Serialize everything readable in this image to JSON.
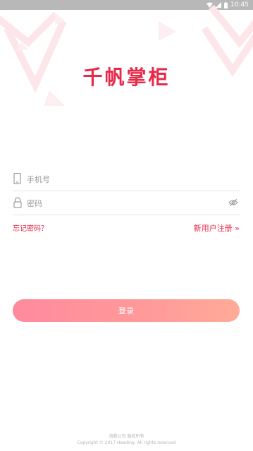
{
  "status_bar": {
    "time": "10:45"
  },
  "brand": {
    "title": "千帆掌柜"
  },
  "form": {
    "phone_placeholder": "手机号",
    "password_placeholder": "密码"
  },
  "links": {
    "forgot_password": "忘记密码？",
    "register": "新用户注册 »"
  },
  "login_button": "登录",
  "footer": {
    "company": "海鼎公司 版权所有",
    "copyright": "Copyright © 2017 Heading. All rights reserved"
  },
  "colors": {
    "brand_red": "#e8294a",
    "button_gradient_start": "#ff8a9c",
    "button_gradient_end": "#ffab98",
    "status_bar": "#b8b8b8"
  },
  "icons": [
    "wifi-icon",
    "signal-icon",
    "battery-icon",
    "phone-icon",
    "lock-icon",
    "eye-hidden-icon"
  ]
}
